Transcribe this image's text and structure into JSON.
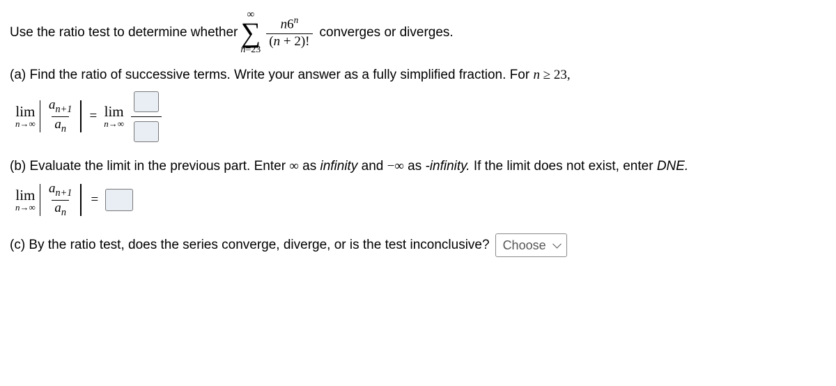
{
  "q": {
    "intro_pre": "Use the ratio test to determine whether",
    "intro_post": "converges or diverges.",
    "sum_top": "∞",
    "sum_bottom_n": "n",
    "sum_bottom_eq": "=23",
    "series_num_n": "n",
    "series_num_base": "6",
    "series_num_exp": "n",
    "series_den_pre": "(",
    "series_den_n": "n",
    "series_den_post": " + 2)!"
  },
  "a": {
    "prompt_pre": "(a) Find the ratio of successive terms. Write your answer as a fully simplified fraction. For ",
    "prompt_cond_n": "n",
    "prompt_cond_rel": " ≥ 23,",
    "lim_label": "lim",
    "lim_under_n": "n",
    "lim_under_arrow": "→∞",
    "ratio_num_a": "a",
    "ratio_num_sub": "n+1",
    "ratio_den_a": "a",
    "ratio_den_sub": "n",
    "equals": "=",
    "answer_num": "",
    "answer_den": ""
  },
  "b": {
    "prompt_pre": "(b) Evaluate the limit in the previous part. Enter ",
    "inf": "∞",
    "as1": " as ",
    "infinity_word": "infinity",
    "and": " and ",
    "neg_inf": "−∞",
    "as2": " as ",
    "neg_infinity_word": "-infinity.",
    "tail": " If the limit does not exist, enter ",
    "dne": "DNE.",
    "lim_label": "lim",
    "lim_under_n": "n",
    "lim_under_arrow": "→∞",
    "ratio_num_a": "a",
    "ratio_num_sub": "n+1",
    "ratio_den_a": "a",
    "ratio_den_sub": "n",
    "equals": "=",
    "answer": ""
  },
  "c": {
    "prompt": "(c) By the ratio test, does the series converge, diverge, or is the test inconclusive?",
    "select_placeholder": "Choose"
  }
}
